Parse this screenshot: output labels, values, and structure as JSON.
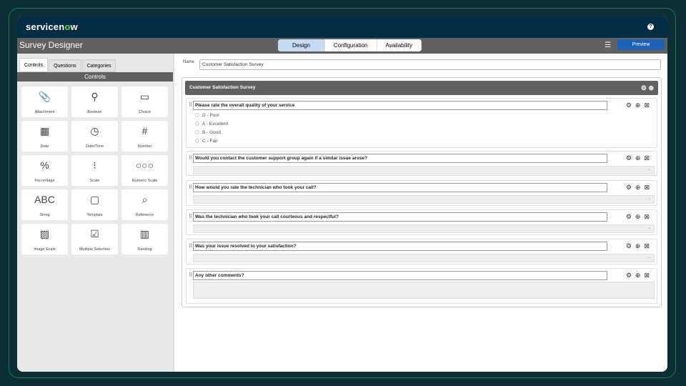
{
  "brand": {
    "logo": "servicenow"
  },
  "titlebar": {
    "title": "Survey Designer",
    "tabs": [
      "Design",
      "Configuration",
      "Availability"
    ],
    "preview": "Preview"
  },
  "left": {
    "tabs": [
      "Controls",
      "Questions",
      "Categories"
    ],
    "header": "Controls",
    "controls": [
      "Attachment",
      "Boolean",
      "Choice",
      "Date",
      "Date/Time",
      "Number",
      "Percentage",
      "Scale",
      "Numeric Scale",
      "String",
      "Template",
      "Reference",
      "Image Scale",
      "Multiple Selection",
      "Ranking"
    ]
  },
  "form": {
    "name_label": "Name",
    "name_value": "Customer Satisfaction Survey"
  },
  "survey": {
    "title": "Customer Satisfaction Survey",
    "questions": [
      {
        "text": "Please rate the overall quality of your service",
        "options": [
          "D - Poor",
          "A - Excellent",
          "B - Good",
          "C - Fair"
        ]
      },
      {
        "text": "Would you contact the customer support group again if a similar issue arose?"
      },
      {
        "text": "How would you rate the technician who took your call?"
      },
      {
        "text": "Was the technician who took your call courteous and respectful?"
      },
      {
        "text": "Was your issue resolved to your satisfaction?"
      },
      {
        "text": "Any other comments?"
      }
    ]
  }
}
